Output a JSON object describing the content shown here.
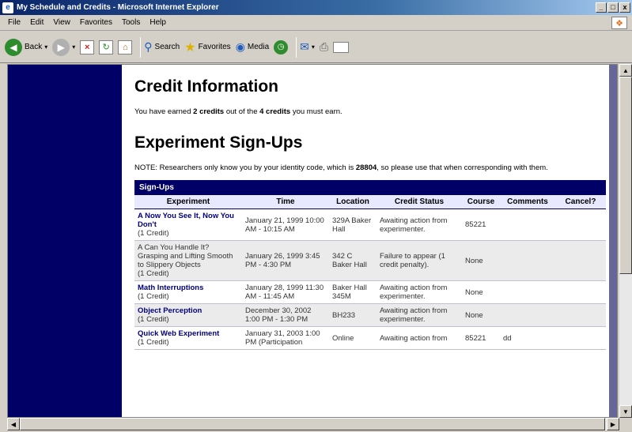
{
  "window": {
    "title": "My Schedule and Credits - Microsoft Internet Explorer",
    "buttons": [
      "_",
      "□",
      "x"
    ]
  },
  "menu": [
    "File",
    "Edit",
    "View",
    "Favorites",
    "Tools",
    "Help"
  ],
  "toolbar": {
    "back": "Back",
    "search": "Search",
    "favorites": "Favorites",
    "media": "Media"
  },
  "page": {
    "credit_heading": "Credit Information",
    "credit_text": {
      "prefix": "You have earned ",
      "earned": "2 credits",
      "middle": " out of the ",
      "required": "4 credits",
      "suffix": " you must earn."
    },
    "signup_heading": "Experiment Sign-Ups",
    "note": {
      "prefix": "NOTE: Researchers only know you by your identity code, which is ",
      "code": "28804",
      "suffix": ", so please use that when corresponding with them."
    },
    "table": {
      "caption": "Sign-Ups",
      "headers": [
        "Experiment",
        "Time",
        "Location",
        "Credit Status",
        "Course",
        "Comments",
        "Cancel?"
      ],
      "rows": [
        {
          "experiment": "A Now You See It, Now You Don't",
          "credit": "(1 Credit)",
          "time": "January 21, 1999 10:00 AM - 10:15 AM",
          "location": "329A Baker Hall",
          "status": "Awaiting action from experimenter.",
          "course": "85221",
          "comments": "",
          "cancel": ""
        },
        {
          "experiment": "A Can You Handle It? Grasping and Lifting Smooth to Slippery Objects",
          "credit": "(1 Credit)",
          "time": "January 26, 1999 3:45 PM - 4:30 PM",
          "location": "342 C Baker Hall",
          "status": "Failure to appear (1 credit penalty).",
          "course": "None",
          "comments": "",
          "cancel": ""
        },
        {
          "experiment": "Math Interruptions",
          "credit": "(1 Credit)",
          "time": "January 28, 1999 11:30 AM - 11:45 AM",
          "location": "Baker Hall 345M",
          "status": "Awaiting action from experimenter.",
          "course": "None",
          "comments": "",
          "cancel": ""
        },
        {
          "experiment": "Object Perception",
          "credit": "(1 Credit)",
          "time": "December 30, 2002 1:00 PM - 1:30 PM",
          "location": "BH233",
          "status": "Awaiting action from experimenter.",
          "course": "None",
          "comments": "",
          "cancel": ""
        },
        {
          "experiment": "Quick Web Experiment",
          "credit": "(1 Credit)",
          "time": "January 31, 2003 1:00 PM (Participation",
          "location": "Online",
          "status": "Awaiting action from",
          "course": "85221",
          "comments": "dd",
          "cancel": ""
        }
      ]
    }
  }
}
